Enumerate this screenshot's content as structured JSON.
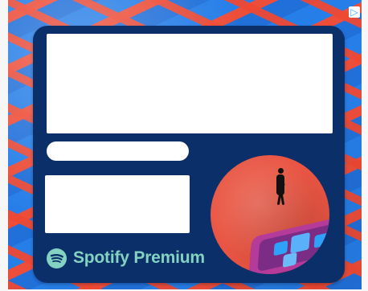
{
  "ad": {
    "brand_name": "Spotify Premium",
    "adchoices_icon": "adchoices-icon",
    "colors": {
      "card_bg": "#0b2f69",
      "brand_green": "#84d2c1",
      "art_bg": "#e95542",
      "phone": "#b53b9b",
      "tile_blue": "#2aa8ff"
    }
  }
}
